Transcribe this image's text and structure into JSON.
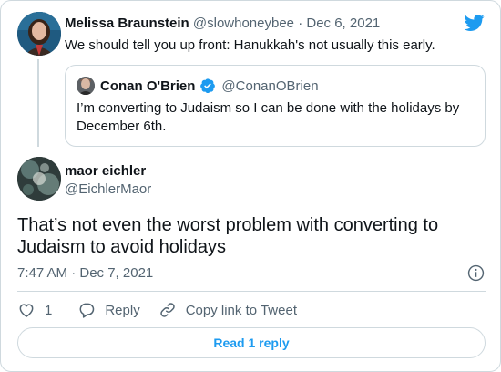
{
  "colors": {
    "brand": "#1d9bf0",
    "text": "#0f1419",
    "muted": "#536471",
    "border": "#cfd9de"
  },
  "icons": [
    "twitter-logo",
    "verified-badge-icon",
    "info-icon",
    "heart-icon",
    "reply-icon",
    "link-icon"
  ],
  "tweet1": {
    "author_name": "Melissa Braunstein",
    "handle": "@slowhoneybee",
    "separator": "·",
    "date": "Dec 6, 2021",
    "text": "We should tell you up front: Hanukkah's not usually this early."
  },
  "quote": {
    "author_name": "Conan O'Brien",
    "handle": "@ConanOBrien",
    "text": "I’m converting to Judaism so I can be done with the holidays by December 6th."
  },
  "tweet2": {
    "author_name": "maor eichler",
    "handle": "@EichlerMaor",
    "text": "That’s not even the worst problem with converting to Judaism to avoid holidays",
    "timestamp": "7:47 AM · Dec 7, 2021"
  },
  "actions": {
    "like_count": "1",
    "reply_label": "Reply",
    "copy_link_label": "Copy link to Tweet"
  },
  "read_replies_label": "Read 1 reply"
}
